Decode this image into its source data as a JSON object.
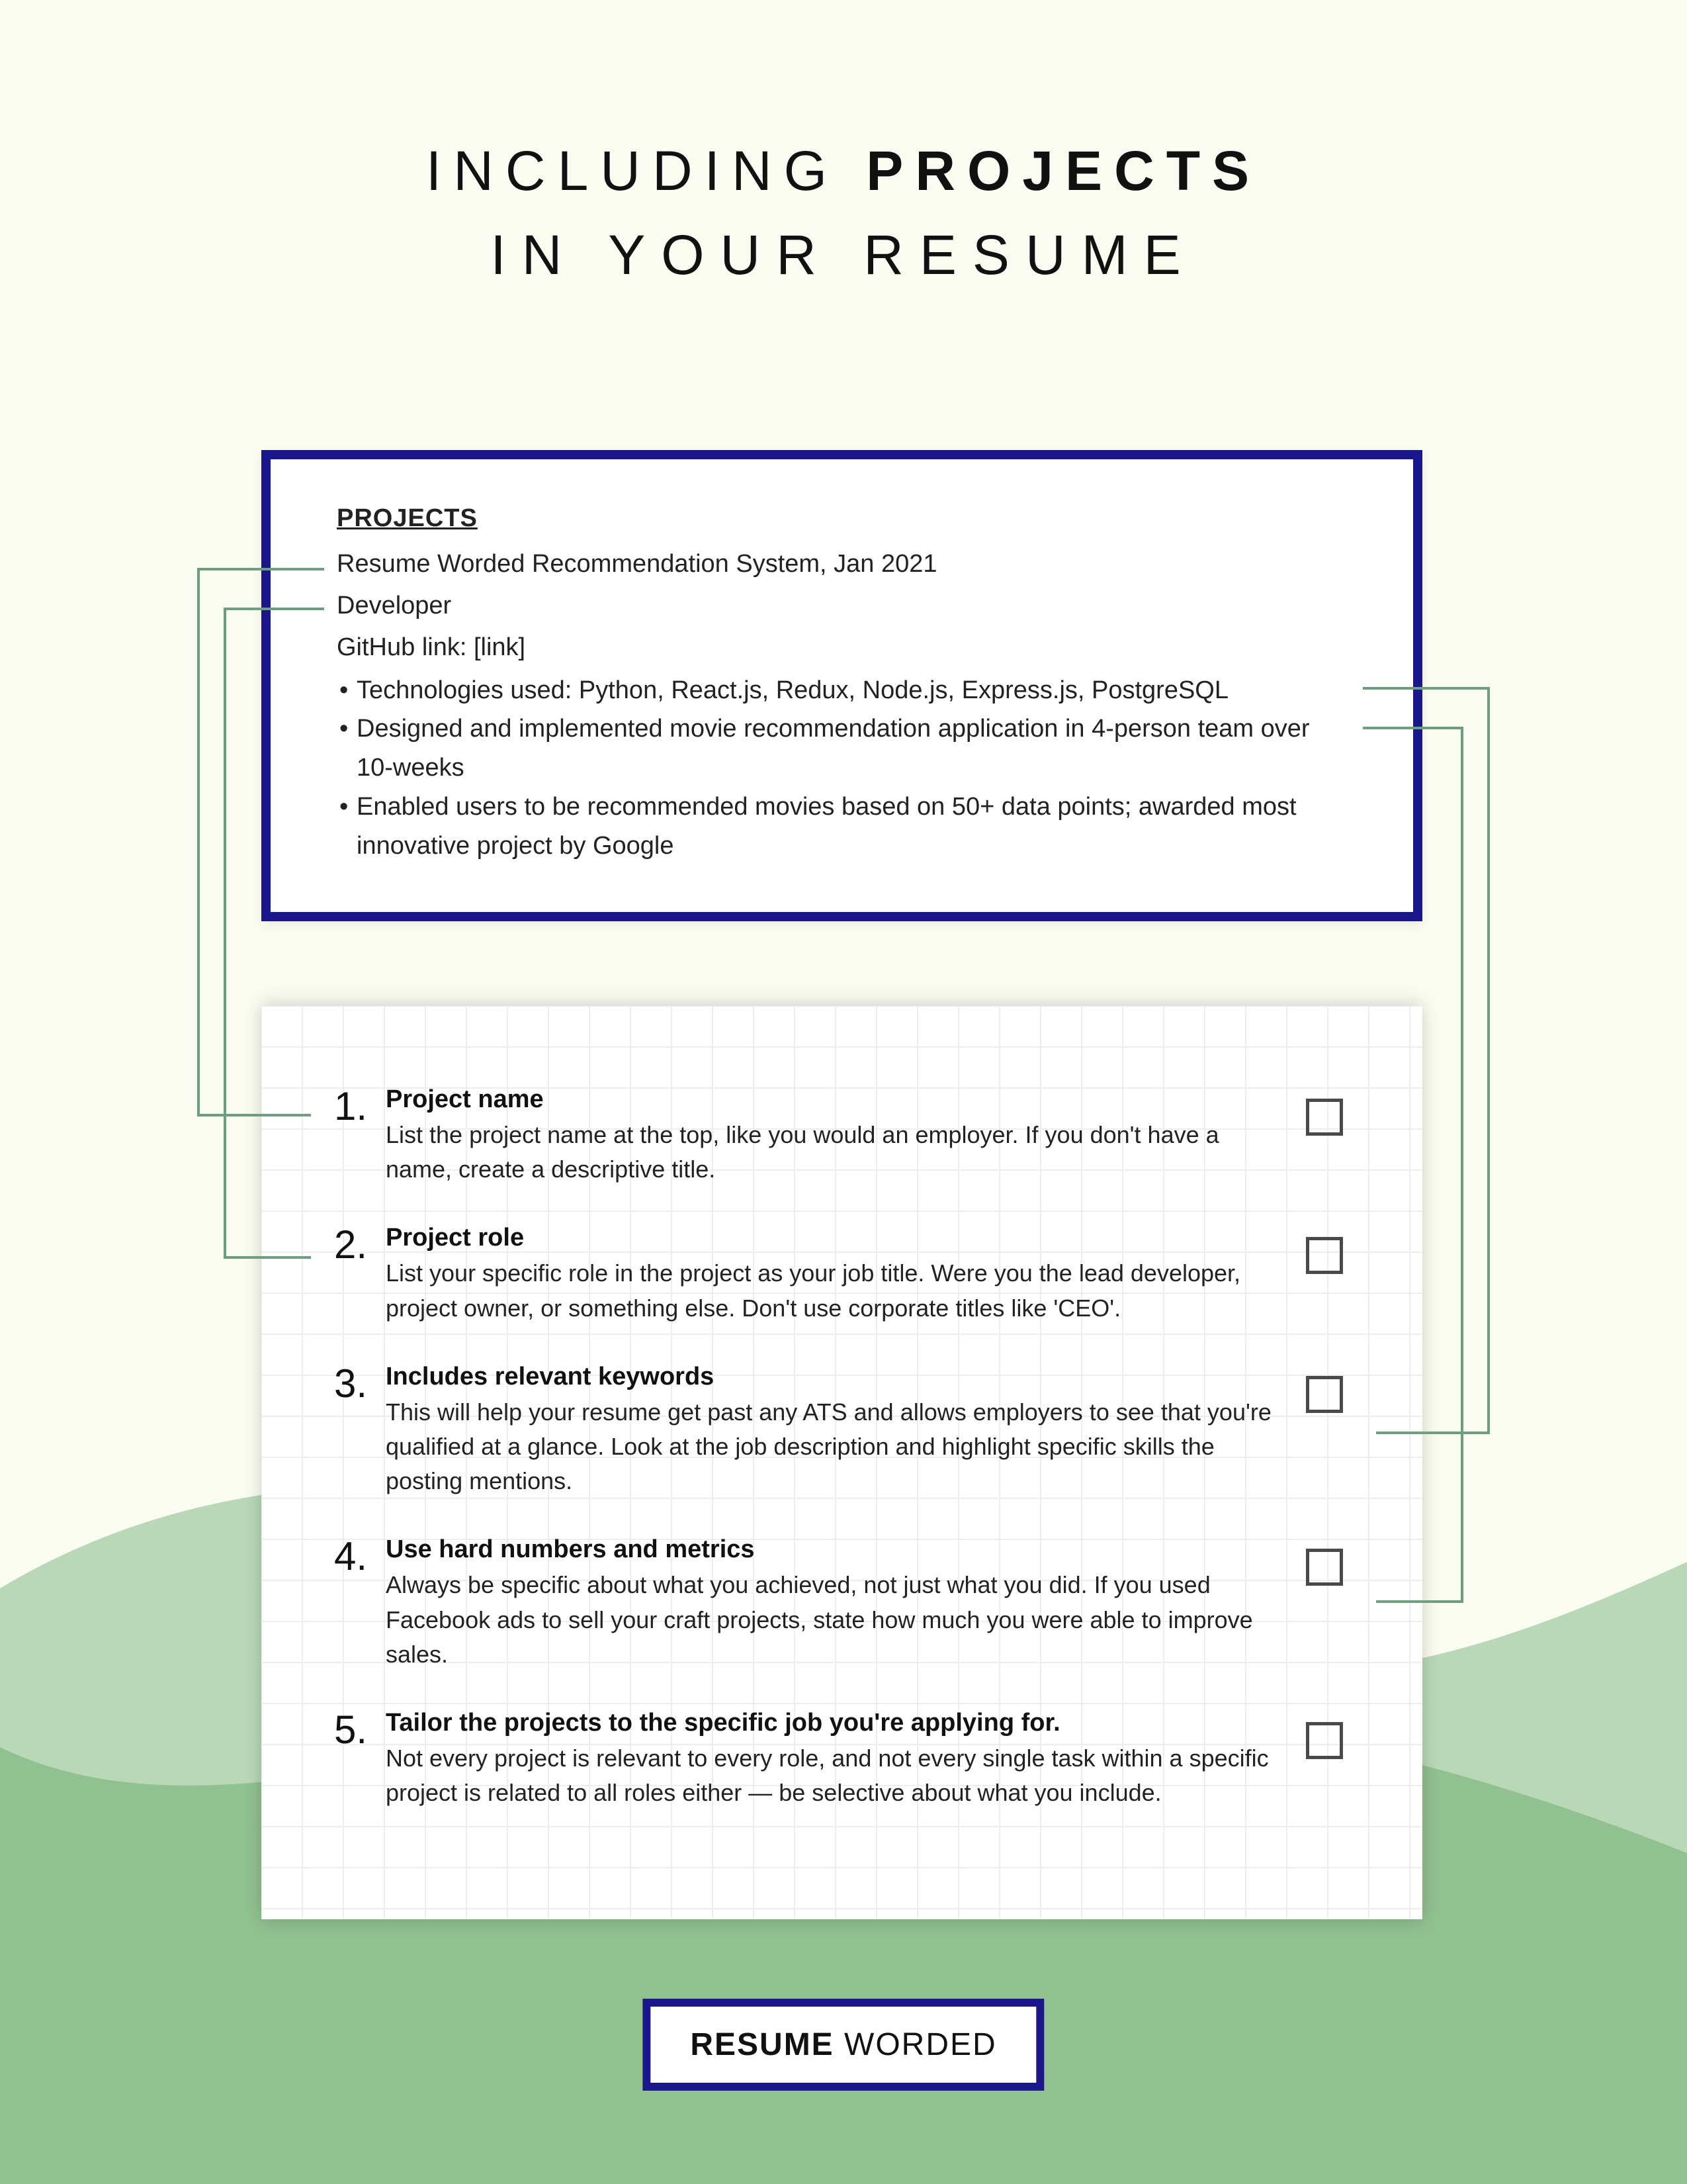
{
  "title": {
    "line1_a": "INCLUDING ",
    "line1_b": "PROJECTS",
    "line2": "IN YOUR RESUME"
  },
  "example": {
    "heading": "PROJECTS",
    "name": "Resume Worded Recommendation System, Jan 2021",
    "role": "Developer",
    "link": "GitHub link: [link]",
    "bullet1": "Technologies used: Python, React.js, Redux, Node.js, Express.js, PostgreSQL",
    "bullet2": "Designed and implemented movie recommendation application in 4-person team over 10-weeks",
    "bullet3": "Enabled users to be recommended movies based on 50+ data points; awarded most innovative project by Google"
  },
  "checklist": [
    {
      "num": "1.",
      "title": "Project name",
      "body": "List the project name at the top, like you would an employer. If you don't have a name, create a descriptive title."
    },
    {
      "num": "2.",
      "title": "Project role",
      "body": "List your specific role in the project as your job title. Were you the lead developer, project owner, or something else. Don't use corporate titles like 'CEO'."
    },
    {
      "num": "3.",
      "title": "Includes relevant keywords",
      "body": "This will help your resume get past any ATS and allows employers to see that you're qualified at a glance. Look at the job description and highlight specific skills the posting mentions."
    },
    {
      "num": "4.",
      "title": "Use hard numbers and metrics",
      "body": "Always be specific about what you achieved, not just what you did. If you used Facebook ads to sell your craft projects, state how much you were able to improve sales."
    },
    {
      "num": "5.",
      "title": "Tailor the projects to the specific job you're applying for.",
      "body": "Not every project is relevant to every role, and not every single task within a specific project is related to all roles either — be selective about what you include."
    }
  ],
  "badge": {
    "a": "RESUME",
    "b": " WORDED"
  },
  "colors": {
    "accent": "#1a168d",
    "wave_light": "#b9d9b6",
    "wave_dark": "#92c191",
    "connector": "#6aa07c"
  }
}
